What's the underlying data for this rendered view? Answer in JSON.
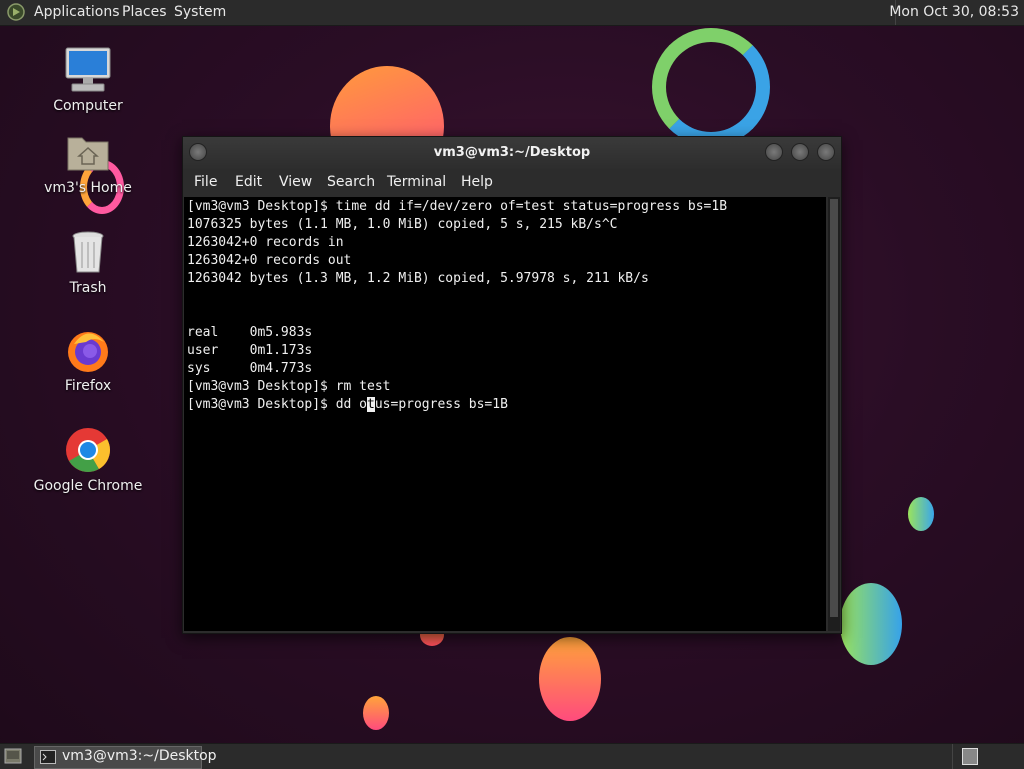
{
  "top_panel": {
    "menus": [
      "Applications",
      "Places",
      "System"
    ],
    "clock": "Mon Oct 30, 08:53"
  },
  "desktop_icons": [
    {
      "label": "Computer",
      "icon": "computer-icon"
    },
    {
      "label": "vm3's Home",
      "icon": "home-folder-icon"
    },
    {
      "label": "Trash",
      "icon": "trash-icon"
    },
    {
      "label": "Firefox",
      "icon": "firefox-icon"
    },
    {
      "label": "Google Chrome",
      "icon": "chrome-icon"
    }
  ],
  "terminal": {
    "title": "vm3@vm3:~/Desktop",
    "menu": [
      "File",
      "Edit",
      "View",
      "Search",
      "Terminal",
      "Help"
    ],
    "lines": [
      "[vm3@vm3 Desktop]$ time dd if=/dev/zero of=test status=progress bs=1B",
      "1076325 bytes (1.1 MB, 1.0 MiB) copied, 5 s, 215 kB/s^C",
      "1263042+0 records in",
      "1263042+0 records out",
      "1263042 bytes (1.3 MB, 1.2 MiB) copied, 5.97978 s, 211 kB/s",
      "",
      "",
      "real    0m5.983s",
      "user    0m1.173s",
      "sys     0m4.773s",
      "[vm3@vm3 Desktop]$ rm test"
    ],
    "current_line_before": "[vm3@vm3 Desktop]$ dd o",
    "current_line_cursor": "t",
    "current_line_after": "us=progress bs=1B"
  },
  "taskbar": {
    "window_label": "vm3@vm3:~/Desktop"
  },
  "colors": {
    "panel": "#2b2b2b",
    "terminal_bg": "#000000",
    "terminal_fg": "#f0f0f0"
  }
}
